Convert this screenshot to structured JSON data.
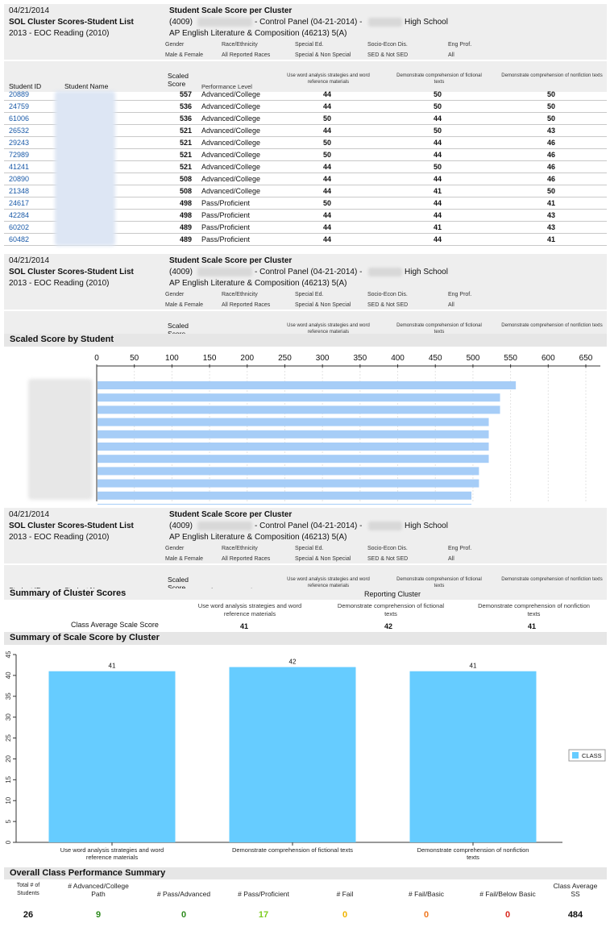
{
  "header": {
    "date": "04/21/2014",
    "report_title": "SOL Cluster Scores-Student List",
    "test": "2013 - EOC Reading (2010)",
    "center_title": "Student Scale Score per Cluster",
    "division_code": "(4009)",
    "control_panel": "- Control Panel (04-21-2014) -",
    "school_suffix": "High School",
    "course": "AP English Literature & Composition (46213) 5(A)",
    "filters": [
      {
        "label": "Gender",
        "value": "Male & Female"
      },
      {
        "label": "Race/Ethnicity",
        "value": "All Reported Races"
      },
      {
        "label": "Special Ed.",
        "value": "Special & Non Special"
      },
      {
        "label": "Socio-Econ Dis.",
        "value": "SED & Not SED"
      },
      {
        "label": "Eng Prof.",
        "value": "All"
      }
    ]
  },
  "columns": {
    "student_id": "Student ID",
    "student_name": "Student Name",
    "scaled_score": "Scaled Score",
    "performance_level": "Performance Level",
    "cluster1": "Use word analysis strategies and word reference materials",
    "cluster2": "Demonstrate comprehension of fictional texts",
    "cluster3": "Demonstrate comprehension of nonfiction texts"
  },
  "students": [
    {
      "id": "20889",
      "score": "557",
      "level": "Advanced/College",
      "c1": "44",
      "c2": "50",
      "c3": "50"
    },
    {
      "id": "24759",
      "score": "536",
      "level": "Advanced/College",
      "c1": "44",
      "c2": "50",
      "c3": "50"
    },
    {
      "id": "61006",
      "score": "536",
      "level": "Advanced/College",
      "c1": "50",
      "c2": "44",
      "c3": "50"
    },
    {
      "id": "26532",
      "score": "521",
      "level": "Advanced/College",
      "c1": "44",
      "c2": "50",
      "c3": "43"
    },
    {
      "id": "29243",
      "score": "521",
      "level": "Advanced/College",
      "c1": "50",
      "c2": "44",
      "c3": "46"
    },
    {
      "id": "72989",
      "score": "521",
      "level": "Advanced/College",
      "c1": "50",
      "c2": "44",
      "c3": "46"
    },
    {
      "id": "41241",
      "score": "521",
      "level": "Advanced/College",
      "c1": "44",
      "c2": "50",
      "c3": "46"
    },
    {
      "id": "20890",
      "score": "508",
      "level": "Advanced/College",
      "c1": "44",
      "c2": "44",
      "c3": "46"
    },
    {
      "id": "21348",
      "score": "508",
      "level": "Advanced/College",
      "c1": "44",
      "c2": "41",
      "c3": "50"
    },
    {
      "id": "24617",
      "score": "498",
      "level": "Pass/Proficient",
      "c1": "50",
      "c2": "44",
      "c3": "41"
    },
    {
      "id": "42284",
      "score": "498",
      "level": "Pass/Proficient",
      "c1": "44",
      "c2": "44",
      "c3": "43"
    },
    {
      "id": "60202",
      "score": "489",
      "level": "Pass/Proficient",
      "c1": "44",
      "c2": "41",
      "c3": "43"
    },
    {
      "id": "60482",
      "score": "489",
      "level": "Pass/Proficient",
      "c1": "44",
      "c2": "44",
      "c3": "41"
    }
  ],
  "scaled_score_section_title": "Scaled Score by Student",
  "summary_section": {
    "title": "Summary of Cluster Scores",
    "reporting_cluster": "Reporting Cluster",
    "class_avg_label": "Class Average Scale Score",
    "cluster_labels": [
      "Use word analysis strategies and word reference materials",
      "Demonstrate comprehension of fictional texts",
      "Demonstrate comprehension of nonfiction texts"
    ],
    "averages": [
      "41",
      "42",
      "41"
    ]
  },
  "cluster_chart_title": "Summary of Scale Score by Cluster",
  "chart_data": [
    {
      "type": "bar",
      "orientation": "horizontal",
      "title": "Scaled Score by Student",
      "xlim": [
        0,
        650
      ],
      "ticks": [
        0,
        50,
        100,
        150,
        200,
        250,
        300,
        350,
        400,
        450,
        500,
        550,
        600,
        650
      ],
      "values": [
        557,
        536,
        536,
        521,
        521,
        521,
        521,
        508,
        508,
        498,
        498
      ],
      "color": "#a6cdf7",
      "grid": true
    },
    {
      "type": "bar",
      "title": "Summary of Scale Score by Cluster",
      "categories": [
        "Use word analysis strategies and word reference materials",
        "Demonstrate comprehension of fictional texts",
        "Demonstrate comprehension of nonfiction texts"
      ],
      "series": [
        {
          "name": "CLASS",
          "values": [
            41,
            42,
            41
          ]
        }
      ],
      "ylim": [
        0,
        45
      ],
      "ticks": [
        0,
        5,
        10,
        15,
        20,
        25,
        30,
        35,
        40,
        45
      ],
      "legend": "right",
      "color": "#66ccff"
    }
  ],
  "overall": {
    "title": "Overall Class Performance Summary",
    "headers": [
      "Total # of Students",
      "# Advanced/College Path",
      "# Pass/Advanced",
      "# Pass/Proficient",
      "# Fail",
      "# Fail/Basic",
      "# Fail/Below Basic",
      "Class Average SS"
    ],
    "values": [
      "26",
      "9",
      "0",
      "17",
      "0",
      "0",
      "0",
      "484"
    ],
    "colors": [
      "#111111",
      "#2e8b1e",
      "#2e8b1e",
      "#7ccc1e",
      "#f0b400",
      "#f07820",
      "#d8281e",
      "#111111"
    ]
  }
}
